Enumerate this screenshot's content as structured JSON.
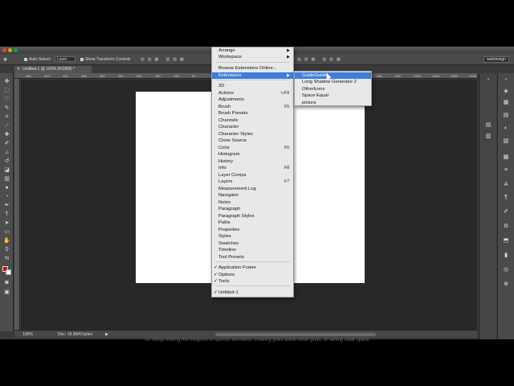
{
  "options_bar": {
    "auto_select_label": "Auto-Select:",
    "auto_select_value": "Layer",
    "transform_controls_label": "Show Transform Controls"
  },
  "workspace": "webdesign",
  "document_tab": "Untitled-1 @ 100% (RGB/8) *",
  "ruler_ticks": [
    "500",
    "450",
    "400",
    "350",
    "300",
    "250",
    "200",
    "150",
    "100",
    "50",
    "0",
    "50",
    "100",
    "150",
    "200",
    "250",
    "300",
    "350",
    "400",
    "450",
    "500",
    "1250",
    "1300",
    "1350",
    "1400",
    "1450",
    "1500",
    "1550",
    "1600",
    "1650",
    "1700"
  ],
  "status": {
    "zoom": "100%",
    "doc_size": "Doc: 18.3M/0 bytes"
  },
  "menu": {
    "items": [
      {
        "label": "Arrange",
        "arrow": "▶"
      },
      {
        "label": "Workspace",
        "arrow": "▶"
      },
      {
        "label": "Browse Extensions Online..."
      },
      {
        "label": "Extensions",
        "arrow": "▶",
        "highlighted": true
      },
      {
        "label": "3D"
      },
      {
        "label": "Actions",
        "shortcut": "⌥F9"
      },
      {
        "label": "Adjustments"
      },
      {
        "label": "Brush",
        "shortcut": "F5"
      },
      {
        "label": "Brush Presets"
      },
      {
        "label": "Channels"
      },
      {
        "label": "Character"
      },
      {
        "label": "Character Styles"
      },
      {
        "label": "Clone Source"
      },
      {
        "label": "Color",
        "shortcut": "F6"
      },
      {
        "label": "Histogram"
      },
      {
        "label": "History"
      },
      {
        "label": "Info",
        "shortcut": "F8"
      },
      {
        "label": "Layer Comps"
      },
      {
        "label": "Layers",
        "shortcut": "F7"
      },
      {
        "label": "Measurement Log"
      },
      {
        "label": "Navigator"
      },
      {
        "label": "Notes"
      },
      {
        "label": "Paragraph"
      },
      {
        "label": "Paragraph Styles"
      },
      {
        "label": "Paths"
      },
      {
        "label": "Properties"
      },
      {
        "label": "Styles"
      },
      {
        "label": "Swatches"
      },
      {
        "label": "Timeline"
      },
      {
        "label": "Tool Presets"
      },
      {
        "label": "Application Frame",
        "checked": "✓"
      },
      {
        "label": "Options",
        "checked": "✓"
      },
      {
        "label": "Tools",
        "checked": "✓"
      },
      {
        "label": "Untitled-1",
        "checked": "✓"
      }
    ]
  },
  "submenu": {
    "items": [
      {
        "label": "GuideGuide",
        "highlighted": true
      },
      {
        "label": "Long Shadow Generator 2"
      },
      {
        "label": "OtherIcons"
      },
      {
        "label": "Space Equal"
      },
      {
        "label": "pictura"
      }
    ]
  },
  "caption": "for things finding the midpoint of specific elements, creating grids within other grids, or setting clear space"
}
